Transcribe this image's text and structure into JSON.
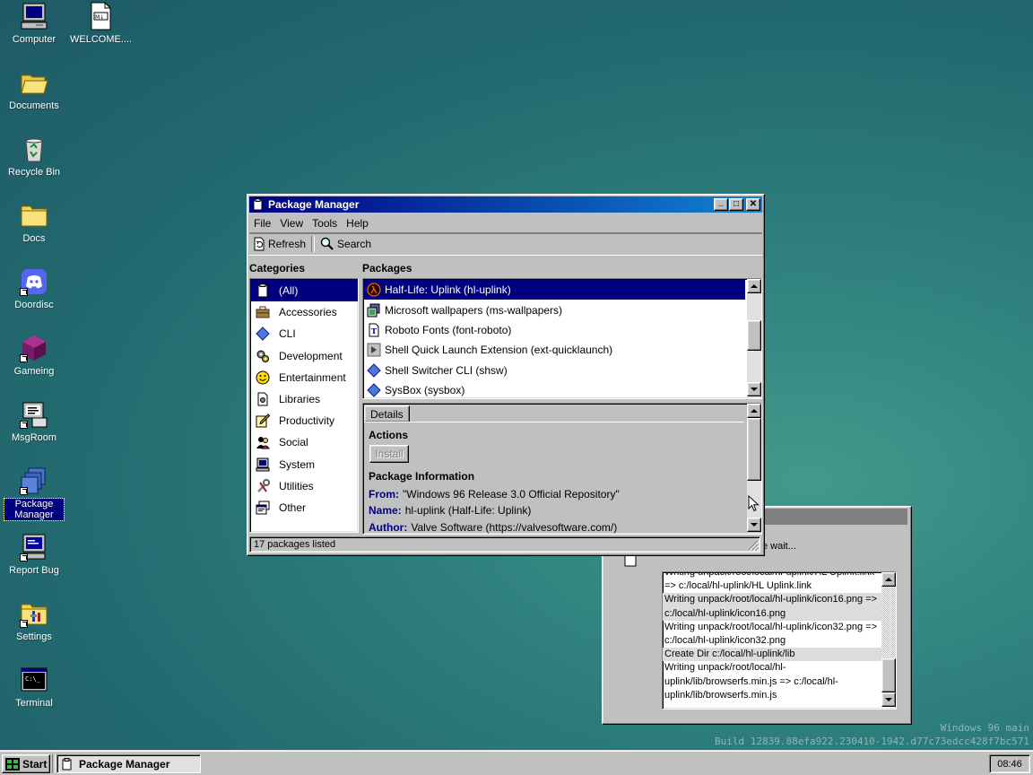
{
  "desktop": {
    "icons": [
      {
        "label": "Computer"
      },
      {
        "label": "WELCOME...."
      },
      {
        "label": "Documents"
      },
      {
        "label": "Recycle Bin"
      },
      {
        "label": "Docs"
      },
      {
        "label": "Doordisc"
      },
      {
        "label": "Gameing"
      },
      {
        "label": "MsgRoom"
      },
      {
        "label": "Package Manager"
      },
      {
        "label": "Report Bug"
      },
      {
        "label": "Settings"
      },
      {
        "label": "Terminal"
      }
    ],
    "watermark": {
      "line1": "Windows 96 main",
      "line2": "Build 12839.88efa922.230410-1942.d77c73edcc428f7bc571"
    }
  },
  "log_window": {
    "status": "e wait...",
    "lines": [
      "Writing unpack/root/local/hl-uplink/HL Uplink.link",
      "=> c:/local/hl-uplink/HL Uplink.link",
      "Writing unpack/root/local/hl-uplink/icon16.png =>",
      "c:/local/hl-uplink/icon16.png",
      "Writing unpack/root/local/hl-uplink/icon32.png =>",
      "c:/local/hl-uplink/icon32.png",
      "Create Dir c:/local/hl-uplink/lib",
      "Writing unpack/root/local/hl-",
      "uplink/lib/browserfs.min.js => c:/local/hl-",
      "uplink/lib/browserfs.min.js"
    ]
  },
  "window": {
    "title": "Package Manager",
    "controls": {
      "minimize": "_",
      "maximize": "□",
      "close": "✕"
    },
    "menu": [
      "File",
      "View",
      "Tools",
      "Help"
    ],
    "toolbar": {
      "refresh": "Refresh",
      "search": "Search"
    },
    "categories": {
      "title": "Categories",
      "items": [
        "(All)",
        "Accessories",
        "CLI",
        "Development",
        "Entertainment",
        "Libraries",
        "Productivity",
        "Social",
        "System",
        "Utilities",
        "Other"
      ]
    },
    "packages": {
      "title": "Packages",
      "items": [
        "Half-Life: Uplink (hl-uplink)",
        "Microsoft wallpapers (ms-wallpapers)",
        "Roboto Fonts (font-roboto)",
        "Shell Quick Launch Extension (ext-quicklaunch)",
        "Shell Switcher CLI (shsw)",
        "SysBox (sysbox)"
      ]
    },
    "details": {
      "tab": "Details",
      "actions_title": "Actions",
      "install_label": "Install",
      "info_title": "Package Information",
      "from_key": "From:",
      "from_value": "\"Windows 96 Release 3.0 Official Repository\"",
      "name_key": "Name:",
      "name_value": "hl-uplink (Half-Life: Uplink)",
      "author_key": "Author:",
      "author_value": "Valve Software (https://valvesoftware.com/)"
    },
    "status": "17 packages listed"
  },
  "taskbar": {
    "start": "Start",
    "task": "Package Manager",
    "clock": "08:46"
  },
  "colors": {
    "title_start": "#000080",
    "title_end": "#1084d0",
    "selection": "#000080",
    "key_text": "#000080",
    "face": "#c0c0c0"
  }
}
